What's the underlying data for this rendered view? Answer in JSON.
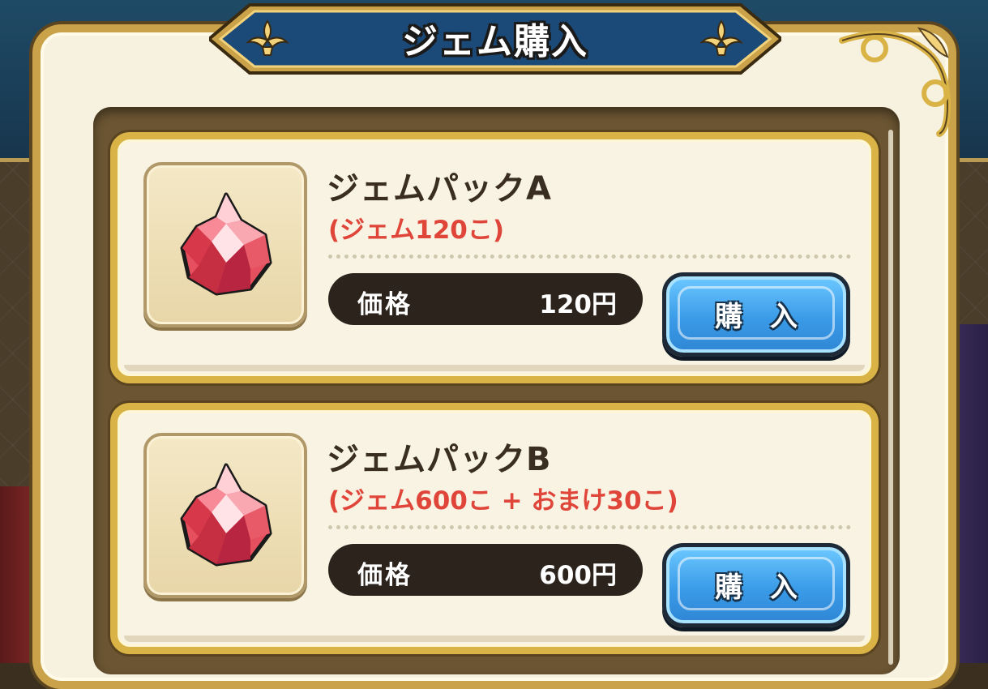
{
  "dialog": {
    "title": "ジェム購入"
  },
  "products": [
    {
      "name": "ジェムパックA",
      "description": "(ジェム120こ)",
      "price_label": "価格",
      "price": "120円",
      "buy_label": "購入",
      "icon": "red-gem-icon"
    },
    {
      "name": "ジェムパックB",
      "description": "(ジェム600こ + おまけ30こ)",
      "price_label": "価格",
      "price": "600円",
      "buy_label": "購入",
      "icon": "red-gem-icon"
    }
  ],
  "colors": {
    "frame_gold": "#c9a24a",
    "description_red": "#e0453a",
    "button_blue": "#3a9be8",
    "price_pill": "#2b231c"
  }
}
